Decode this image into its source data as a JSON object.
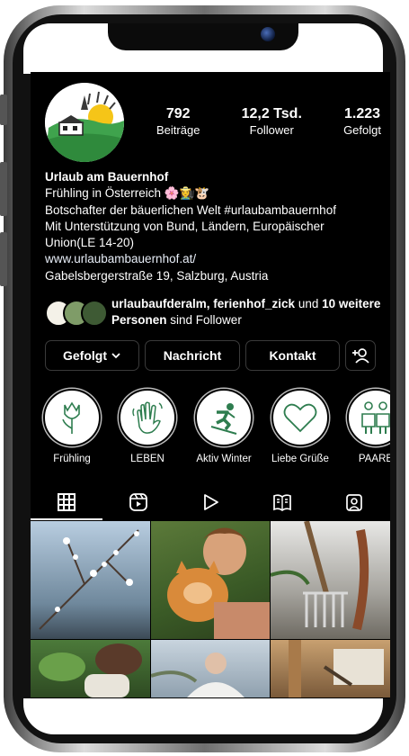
{
  "profile": {
    "stats": [
      {
        "value": "792",
        "label": "Beiträge"
      },
      {
        "value": "12,2 Tsd.",
        "label": "Follower"
      },
      {
        "value": "1.223",
        "label": "Gefolgt"
      }
    ],
    "name": "Urlaub am Bauernhof",
    "bio_line1": "Frühling in Österreich 🌸👩‍🌾🐮",
    "bio_line2": "Botschafter der bäuerlichen Welt #urlaubambauernhof",
    "bio_line3": "Mit Unterstützung von Bund, Ländern, Europäischer",
    "bio_line4": "Union(LE 14-20)",
    "website": "www.urlaubambauernhof.at/",
    "address": "Gabelsbergerstraße 19, Salzburg, Austria",
    "followed_by": {
      "names": "urlaubaufderalm, ferienhof_zick",
      "connector": " und ",
      "others": "10 weitere Personen",
      "suffix": " sind Follower"
    }
  },
  "actions": {
    "following": "Gefolgt",
    "message": "Nachricht",
    "contact": "Kontakt"
  },
  "highlights": [
    {
      "label": "Frühling",
      "icon": "tulip-icon"
    },
    {
      "label": "LEBEN",
      "icon": "waving-hand-icon"
    },
    {
      "label": "Aktiv Winter",
      "icon": "skier-icon"
    },
    {
      "label": "Liebe Grüße",
      "icon": "heart-icon"
    },
    {
      "label": "PAARE",
      "icon": "couple-icon"
    }
  ],
  "tabs": [
    {
      "name": "grid",
      "icon": "grid-icon"
    },
    {
      "name": "reels",
      "icon": "reels-icon"
    },
    {
      "name": "videos",
      "icon": "play-icon"
    },
    {
      "name": "guides",
      "icon": "guide-icon"
    },
    {
      "name": "tagged",
      "icon": "tagged-user-icon"
    }
  ],
  "colors": {
    "screen_bg": "#000000",
    "highlight_green": "#2e7d4f",
    "text": "#ffffff"
  }
}
